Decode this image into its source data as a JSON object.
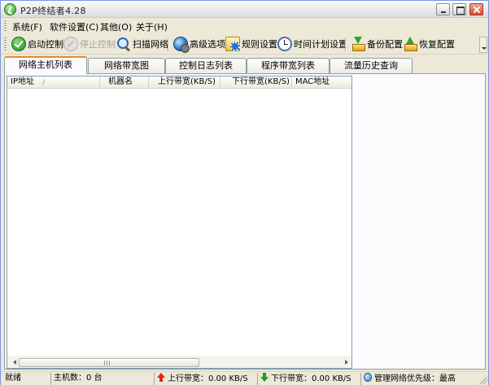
{
  "window": {
    "title": "P2P终结者4.28"
  },
  "menu": {
    "items": [
      "系统(F)",
      "软件设置(C)",
      "其他(O)",
      "关于(H)"
    ]
  },
  "toolbar": {
    "start_label": "启动控制",
    "stop_label": "停止控制",
    "scan_label": "扫描网络",
    "advanced_label": "高级选项",
    "rules_label": "规则设置",
    "schedule_label": "时间计划设置",
    "backup_label": "备份配置",
    "restore_label": "恢复配置"
  },
  "tabs": [
    "网络主机列表",
    "网络带宽图",
    "控制日志列表",
    "程序带宽列表",
    "流量历史查询"
  ],
  "active_tab": "网络主机列表",
  "host_list": {
    "columns": [
      "IP地址",
      "机器名",
      "上行带宽(KB/S)",
      "下行带宽(KB/S)",
      "MAC地址"
    ],
    "sort_indicator": "/",
    "rows": []
  },
  "status": {
    "ready": "就绪",
    "host_count": "主机数：0 台",
    "upload": "上行带宽：0.00 KB/S",
    "download": "下行带宽：0.00 KB/S",
    "priority": "管理网络优先级：最高"
  },
  "scrollbar": {
    "grip": "III"
  }
}
